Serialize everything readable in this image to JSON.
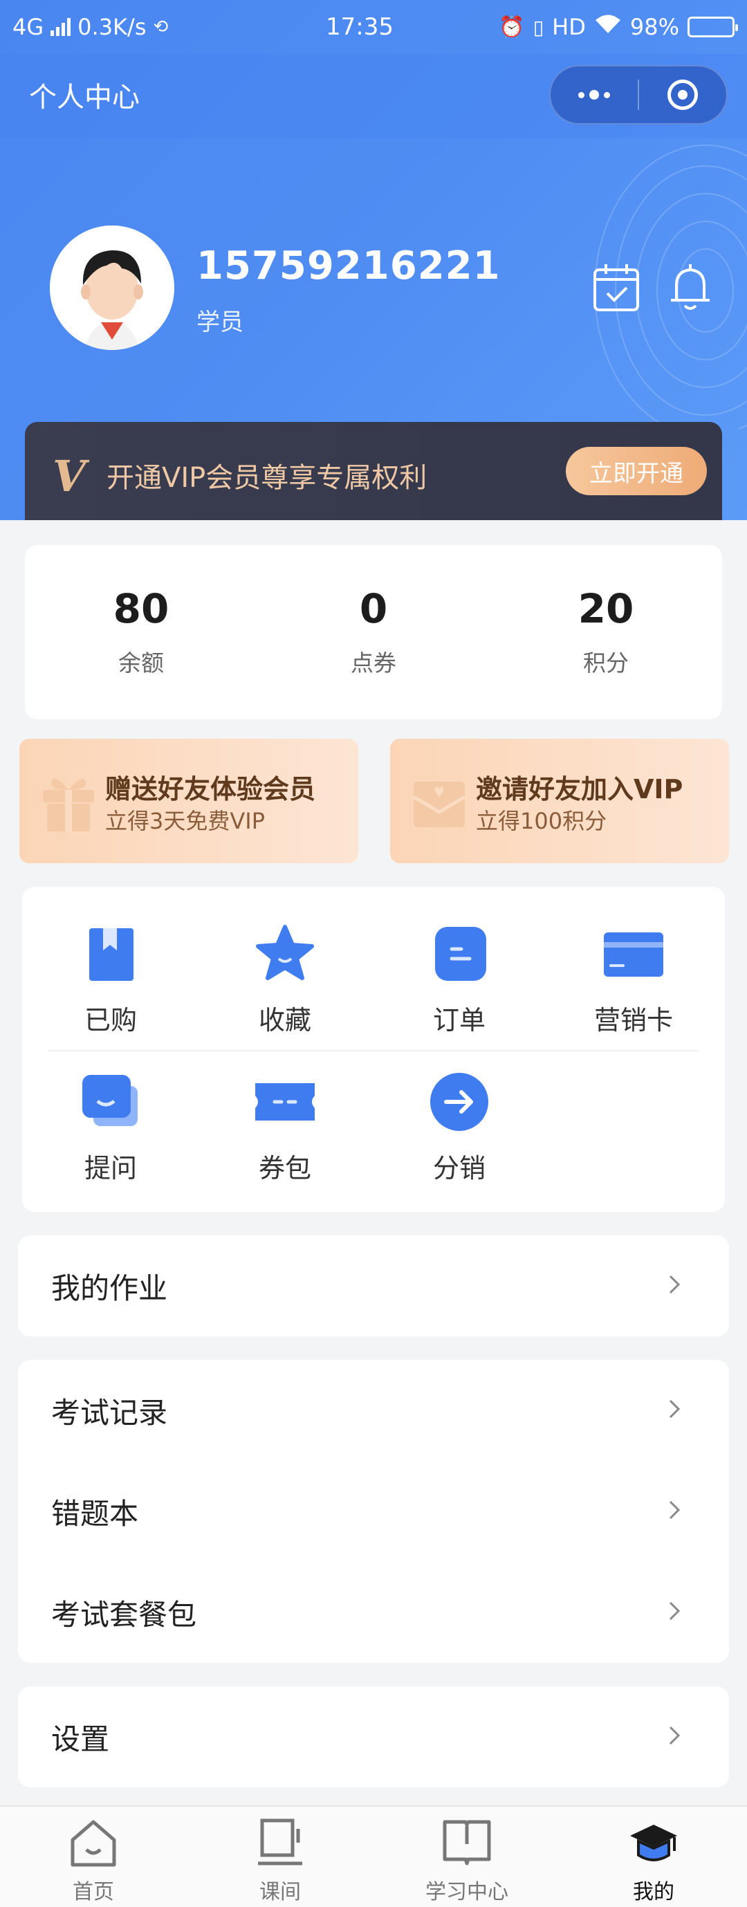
{
  "status_bar": {
    "network": "4G",
    "speed": "0.3K/s",
    "time": "17:35",
    "hd": "HD",
    "battery": "98%"
  },
  "navbar": {
    "title": "个人中心"
  },
  "profile": {
    "phone": "15759216221",
    "role": "学员"
  },
  "vip": {
    "logo": "V",
    "text": "开通VIP会员尊享专属权利",
    "button": "立即开通"
  },
  "stats": [
    {
      "value": "80",
      "label": "余额"
    },
    {
      "value": "0",
      "label": "点券"
    },
    {
      "value": "20",
      "label": "积分"
    }
  ],
  "promos": [
    {
      "title": "赠送好友体验会员",
      "sub": "立得3天免费VIP",
      "icon": "gift-icon"
    },
    {
      "title": "邀请好友加入VIP",
      "sub": "立得100积分",
      "icon": "envelope-icon"
    }
  ],
  "functions": [
    {
      "label": "已购",
      "icon": "bookmark-book-icon"
    },
    {
      "label": "收藏",
      "icon": "star-icon"
    },
    {
      "label": "订单",
      "icon": "order-icon"
    },
    {
      "label": "营销卡",
      "icon": "card-icon"
    },
    {
      "label": "提问",
      "icon": "question-icon"
    },
    {
      "label": "券包",
      "icon": "coupon-icon"
    },
    {
      "label": "分销",
      "icon": "arrow-circle-icon"
    }
  ],
  "lists": {
    "homework": "我的作业",
    "exam_records": "考试记录",
    "wrong_questions": "错题本",
    "exam_packages": "考试套餐包",
    "settings": "设置"
  },
  "tabbar": [
    {
      "label": "首页",
      "icon": "home-icon"
    },
    {
      "label": "课间",
      "icon": "break-cup-icon"
    },
    {
      "label": "学习中心",
      "icon": "book-icon"
    },
    {
      "label": "我的",
      "icon": "graduation-cap-icon"
    }
  ],
  "colors": {
    "primary": "#4f8df3",
    "vip_gold": "#efc9a5",
    "vip_dark": "#373a4d",
    "promo_peach": "#fbd5b6"
  }
}
